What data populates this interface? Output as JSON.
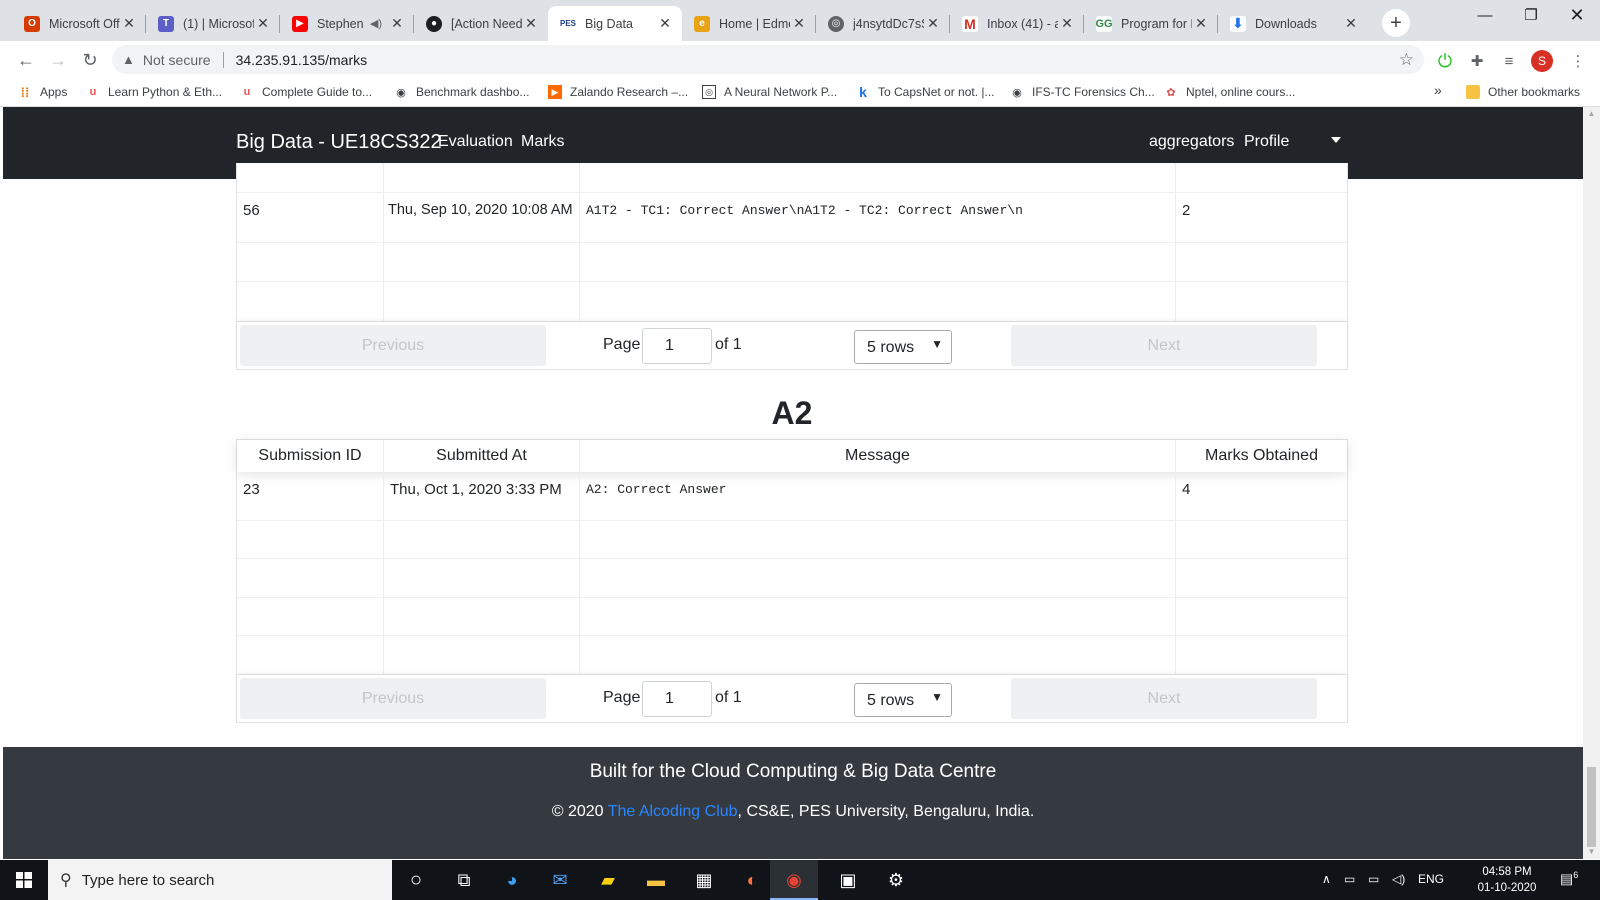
{
  "browser": {
    "tabs": [
      {
        "title": "Microsoft Off",
        "icon": "office-icon",
        "color": "#d83b01"
      },
      {
        "title": "(1) | Microsof",
        "icon": "teams-icon",
        "color": "#5b5fc7"
      },
      {
        "title": "Stephen",
        "icon": "youtube-icon",
        "color": "#ff0000"
      },
      {
        "title": "[Action Need",
        "icon": "github-icon",
        "color": "#1b1f23"
      },
      {
        "title": "Big Data",
        "icon": "pes-icon",
        "color": "#1f3c88"
      },
      {
        "title": "Home | Edmo",
        "icon": "edmodo-icon",
        "color": "#e8a317"
      },
      {
        "title": "j4nsytdDc7sS",
        "icon": "globe-icon",
        "color": "#5f6368"
      },
      {
        "title": "Inbox (41) - a",
        "icon": "gmail-icon",
        "color": "#d93025"
      },
      {
        "title": "Program for F",
        "icon": "gfg-icon",
        "color": "#2f8d46"
      },
      {
        "title": "Downloads",
        "icon": "download-icon",
        "color": "#1a73e8"
      }
    ],
    "active_tab": "Big Data",
    "security_label": "Not secure",
    "url": "34.235.91.135/marks",
    "profile_initial": "S",
    "bookmarks": [
      {
        "label": "Apps",
        "icon": "apps-icon"
      },
      {
        "label": "Learn Python & Eth...",
        "icon": "udemy-icon"
      },
      {
        "label": "Complete Guide to...",
        "icon": "udemy-icon"
      },
      {
        "label": "Benchmark dashbo...",
        "icon": "globe-icon"
      },
      {
        "label": "Zalando Research –...",
        "icon": "zalando-icon"
      },
      {
        "label": "A Neural Network P...",
        "icon": "site-icon"
      },
      {
        "label": "To CapsNet or not. |...",
        "icon": "k-icon"
      },
      {
        "label": "IFS-TC Forensics Ch...",
        "icon": "globe-icon"
      },
      {
        "label": "Nptel, online cours...",
        "icon": "nptel-icon"
      }
    ],
    "bookmarks_overflow": "»",
    "other_bookmarks": "Other bookmarks"
  },
  "navbar": {
    "brand": "Big Data - UE18CS322",
    "links": [
      "Evaluation",
      "Marks"
    ],
    "user": "aggregators",
    "profile": "Profile"
  },
  "a1t2": {
    "row": {
      "id": "56",
      "submitted_at": "Thu, Sep 10, 2020 10:08 AM",
      "message": "A1T2 - TC1: Correct Answer\\nA1T2 - TC2: Correct Answer\\n",
      "marks": "2"
    },
    "pagination": {
      "previous": "Previous",
      "page_label": "Page",
      "page": "1",
      "of_label": "of 1",
      "rows": "5 rows",
      "next": "Next"
    }
  },
  "a2": {
    "title": "A2",
    "columns": [
      "Submission ID",
      "Submitted At",
      "Message",
      "Marks Obtained"
    ],
    "row": {
      "id": "23",
      "submitted_at": "Thu, Oct 1, 2020 3:33 PM",
      "message": "A2: Correct Answer",
      "marks": "4"
    },
    "pagination": {
      "previous": "Previous",
      "page_label": "Page",
      "page": "1",
      "of_label": "of 1",
      "rows": "5 rows",
      "next": "Next"
    }
  },
  "footer": {
    "line1": "Built for the Cloud Computing & Big Data Centre",
    "copyright": "© 2020",
    "club": "The Alcoding Club",
    "rest": ", CS&E, PES University, Bengaluru, India."
  },
  "taskbar": {
    "search_placeholder": "Type here to search",
    "lang": "ENG",
    "time": "04:58 PM",
    "date": "01-10-2020",
    "notifications": "6"
  }
}
